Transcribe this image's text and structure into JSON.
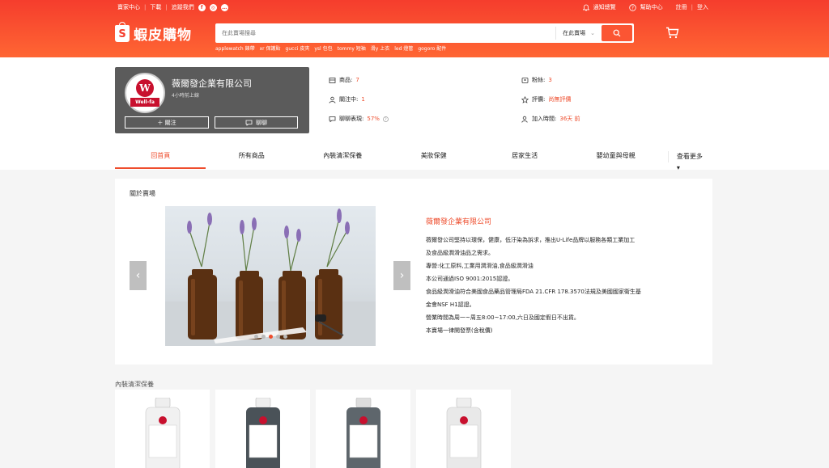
{
  "topbar": {
    "left": [
      "賣家中心",
      "下載",
      "追蹤我們"
    ],
    "notify": "通知總覽",
    "help": "幫助中心",
    "register": "註冊",
    "login": "登入"
  },
  "logo": {
    "text": "蝦皮購物"
  },
  "search": {
    "placeholder": "在此賣場搜尋",
    "scope": "在此賣場",
    "hot": [
      "applewatch 錶帶",
      "xr 保護貼",
      "gucci 皮夾",
      "ysl 包包",
      "tommy 短袖",
      "滑y 上衣",
      "led 燈管",
      "gogoro 配件"
    ]
  },
  "shop": {
    "name": "薇爾發企業有限公司",
    "online": "4小時前上線",
    "logo_letter": "W",
    "logo_badge": "Well-fa",
    "follow": "＋ 關注",
    "chat": "聊聊",
    "stats": [
      {
        "label": "商品:",
        "value": "7"
      },
      {
        "label": "關注中:",
        "value": "1"
      },
      {
        "label": "聊聊表現:",
        "value": "57%"
      },
      {
        "label": "粉絲:",
        "value": "3"
      },
      {
        "label": "評價:",
        "value": "尚無評價"
      },
      {
        "label": "加入時間:",
        "value": "36天 前"
      }
    ]
  },
  "nav": {
    "items": [
      "回首頁",
      "所有商品",
      "內裝清潔保養",
      "美妝保健",
      "居家生活",
      "嬰幼童與母親"
    ],
    "more": "查看更多"
  },
  "about": {
    "title": "關於賣場",
    "company": "薇爾發企業有限公司",
    "lines": [
      "薇爾發公司堅持以環保，健康，低汙染為訴求，推出U-Life品牌以服務各類工業加工",
      "及食品級潤滑油品之需求。",
      "專營:化工原料,工業用潤滑油,食品級潤滑油",
      "本公司通過ISO 9001:2015認證。",
      "食品級潤滑油符合美國食品藥品管理局FDA 21.CFR 178.3570法規及美國國家衛生基",
      "金會NSF H1認證。",
      "營業時間為周一~周五8:00~17:00,六日及國定假日不出貨。",
      "本賣場一律開發票(含稅價)"
    ],
    "dots": 5,
    "active_dot": 3
  },
  "section": {
    "title": "內裝清潔保養"
  },
  "colors": {
    "brand": "#ee4d2d",
    "header_top": "#f53d2d",
    "header_bottom": "#ff6633"
  }
}
